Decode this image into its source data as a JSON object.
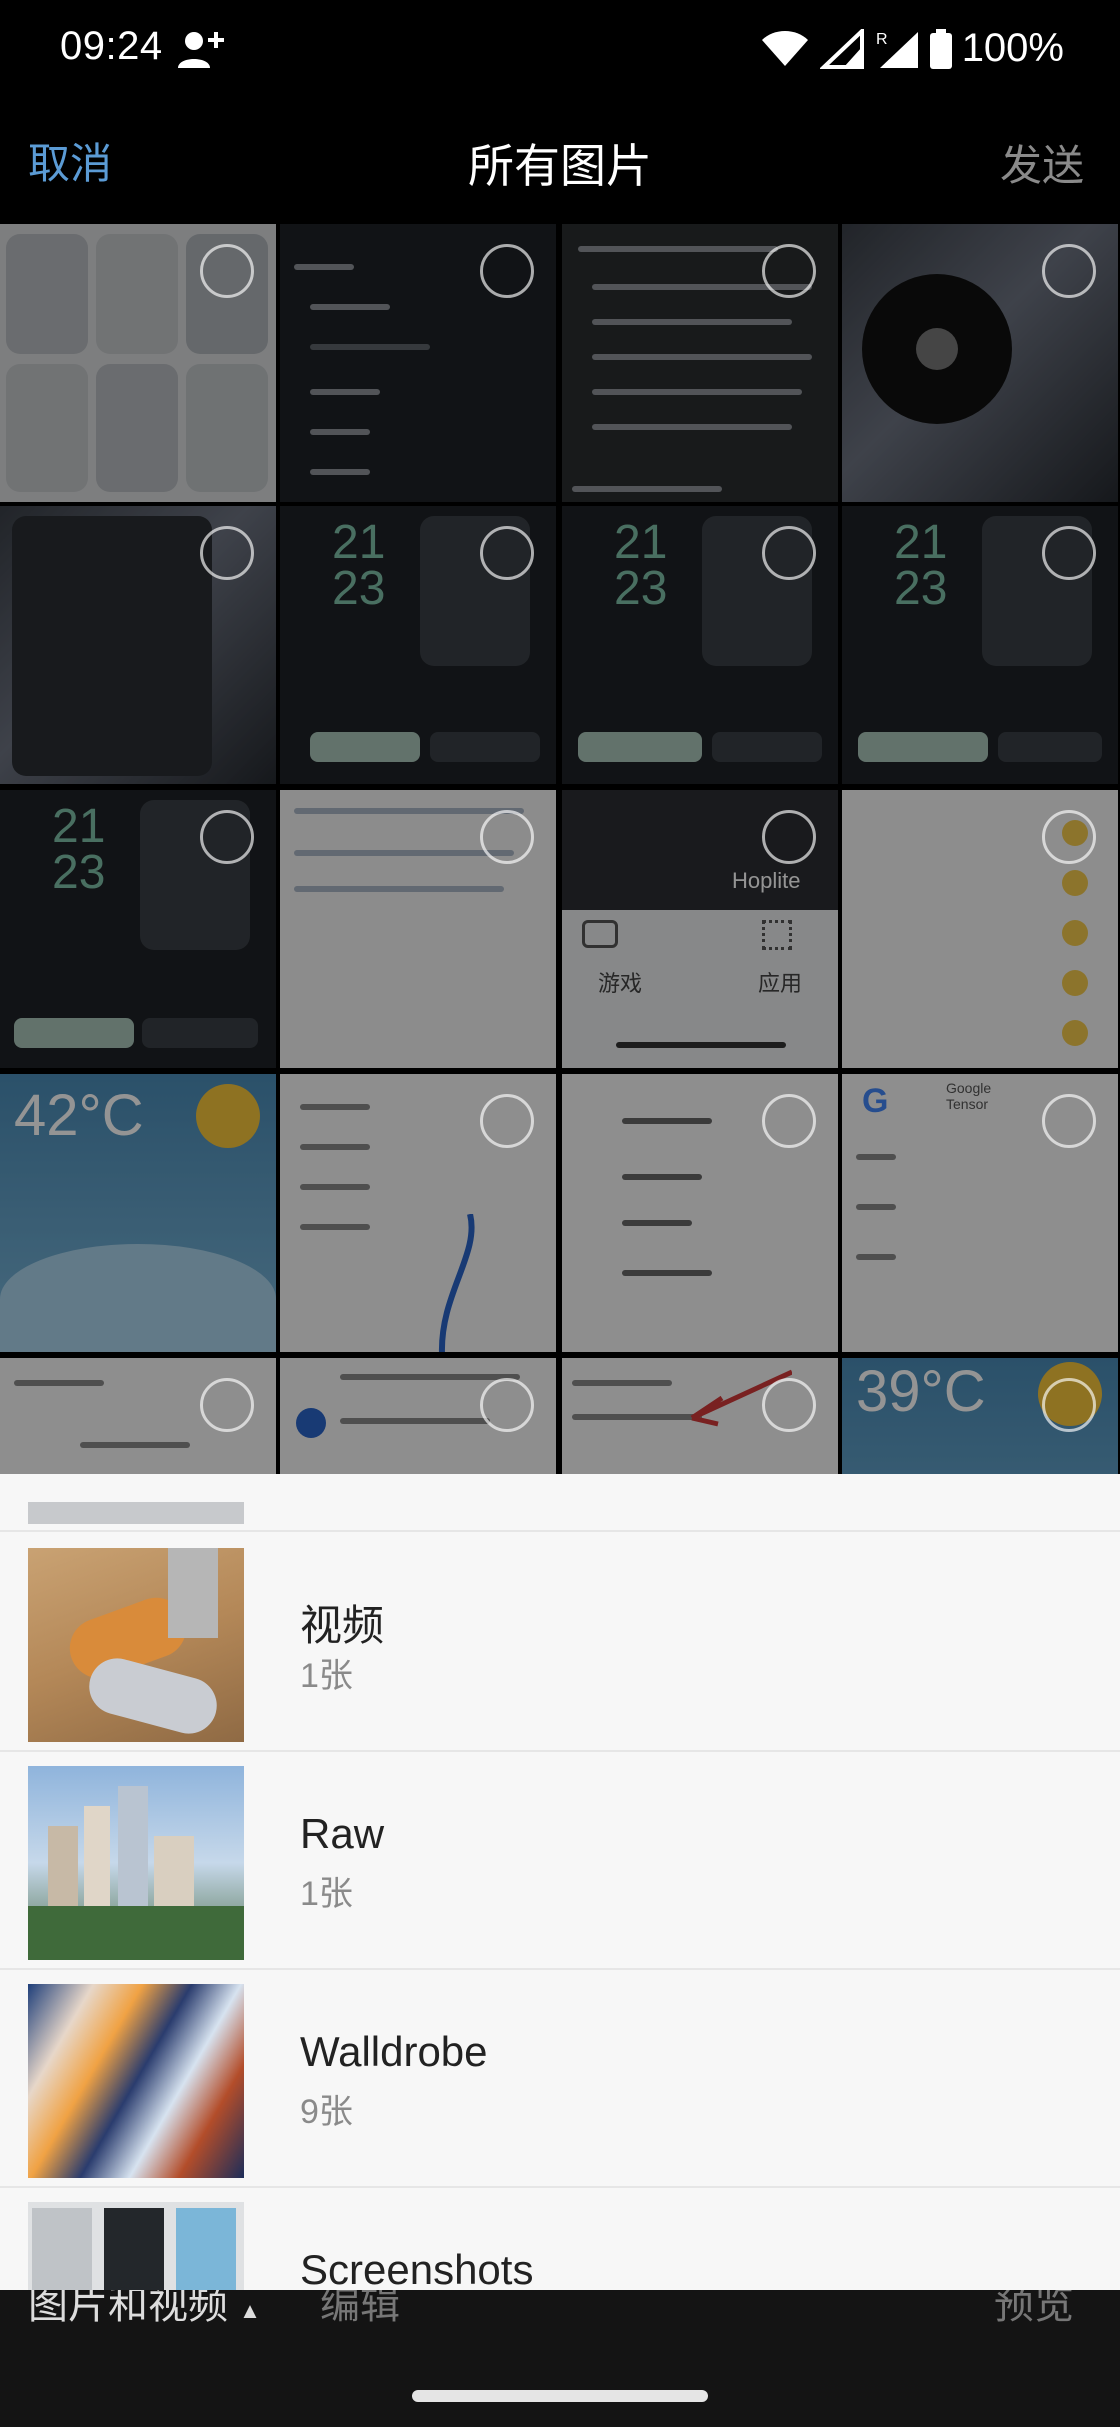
{
  "status_bar": {
    "time": "09:24",
    "battery_text": "100%",
    "roaming_label": "R"
  },
  "header": {
    "cancel": "取消",
    "title": "所有图片",
    "send": "发送"
  },
  "grid": {
    "labels": {
      "game": "游戏",
      "apps": "应用",
      "hoplite": "Hoplite",
      "temp_42": "42°C",
      "temp_39": "39°C",
      "google_tensor": "Google Tensor"
    }
  },
  "albums": [
    {
      "name": "视频",
      "count": "1张"
    },
    {
      "name": "Raw",
      "count": "1张"
    },
    {
      "name": "Walldrobe",
      "count": "9张"
    },
    {
      "name": "Screenshots",
      "count": ""
    }
  ],
  "bottom_bar": {
    "album_selector": "图片和视频",
    "edit": "编辑",
    "preview": "预览"
  },
  "icons": [
    "user-add-icon",
    "wifi-icon",
    "signal-icon",
    "battery-icon",
    "caret-up-icon",
    "gamepad-icon",
    "apps-grid-icon"
  ]
}
